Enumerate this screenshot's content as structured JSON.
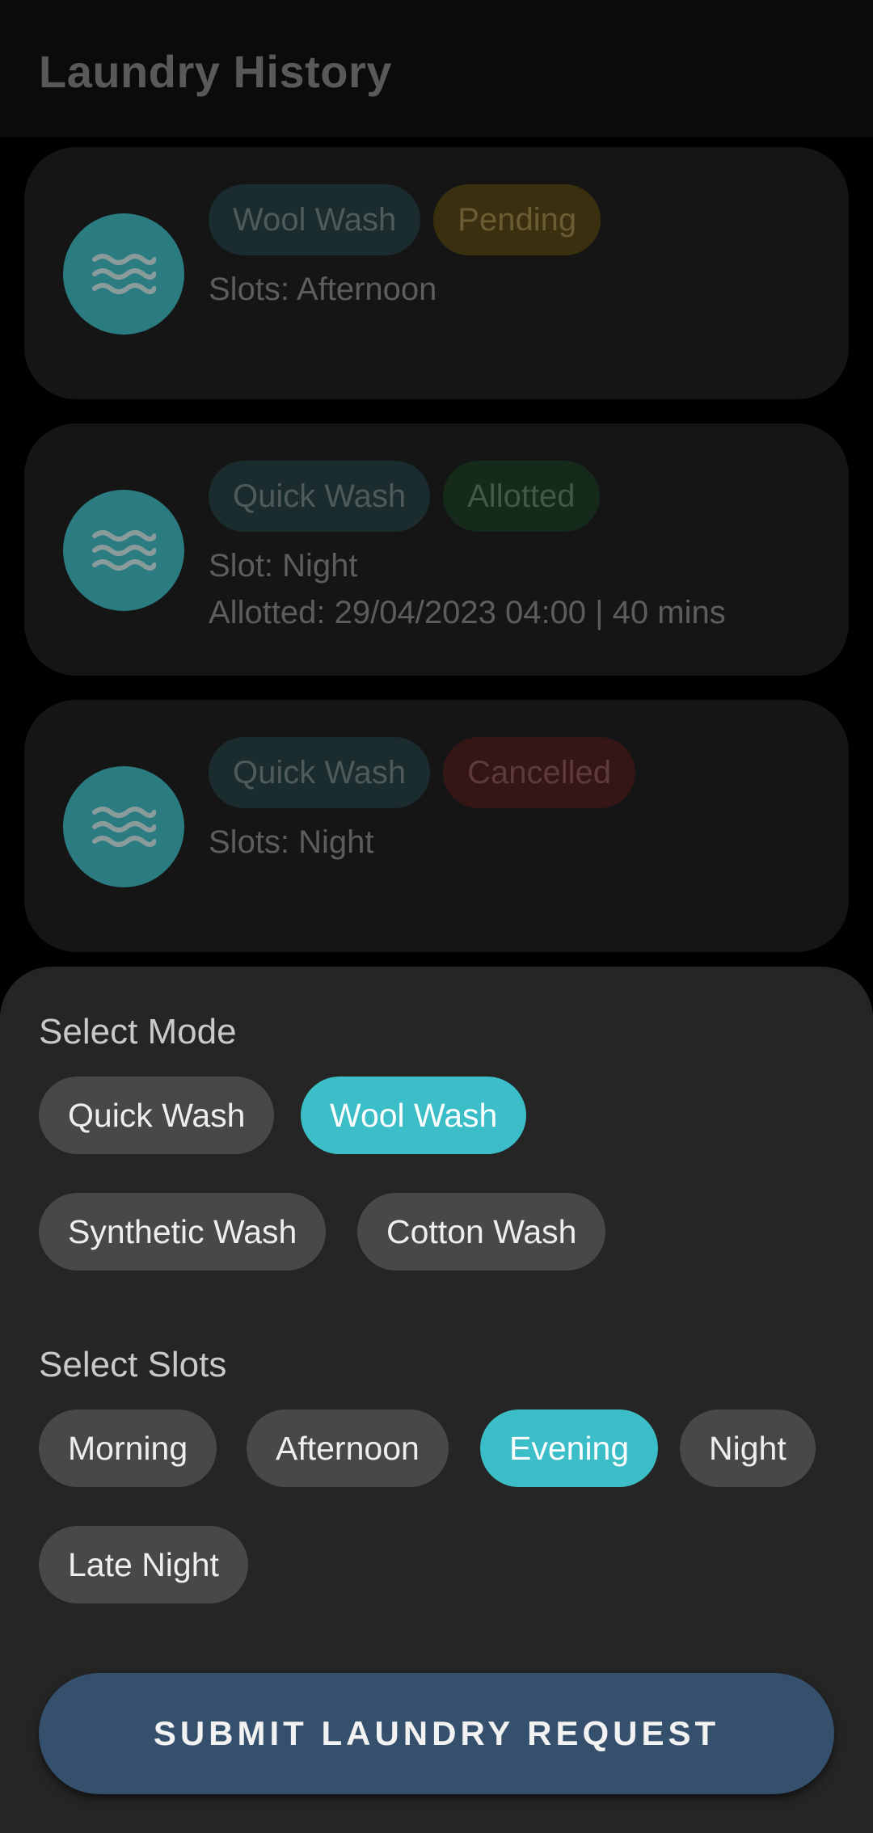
{
  "app_bar": {
    "title": "Laundry History"
  },
  "history": [
    {
      "icon": "waves-icon",
      "mode": "Wool Wash",
      "status": "Pending",
      "status_color": "#3a2f0f",
      "line1": "Slots: Afternoon",
      "line2": ""
    },
    {
      "icon": "waves-icon",
      "mode": "Quick Wash",
      "status": "Allotted",
      "status_color": "#152a1a",
      "line1": "Slot: Night",
      "line2": "Allotted: 29/04/2023 04:00 | 40 mins"
    },
    {
      "icon": "waves-icon",
      "mode": "Quick Wash",
      "status": "Cancelled",
      "status_color": "#341617",
      "line1": "Slots: Night",
      "line2": ""
    }
  ],
  "sheet": {
    "mode_label": "Select Mode",
    "modes": [
      {
        "label": "Quick Wash",
        "selected": false
      },
      {
        "label": "Wool Wash",
        "selected": true
      },
      {
        "label": "Synthetic Wash",
        "selected": false
      },
      {
        "label": "Cotton Wash",
        "selected": false
      }
    ],
    "slots_label": "Select Slots",
    "slots": [
      {
        "label": "Morning",
        "selected": false
      },
      {
        "label": "Afternoon",
        "selected": false
      },
      {
        "label": "Evening",
        "selected": true
      },
      {
        "label": "Night",
        "selected": false
      },
      {
        "label": "Late Night",
        "selected": false
      }
    ],
    "submit_label": "SUBMIT LAUNDRY REQUEST"
  },
  "colors": {
    "accent": "#3bbec8",
    "submit_button": "#34506d",
    "sheet_background": "#252525"
  }
}
